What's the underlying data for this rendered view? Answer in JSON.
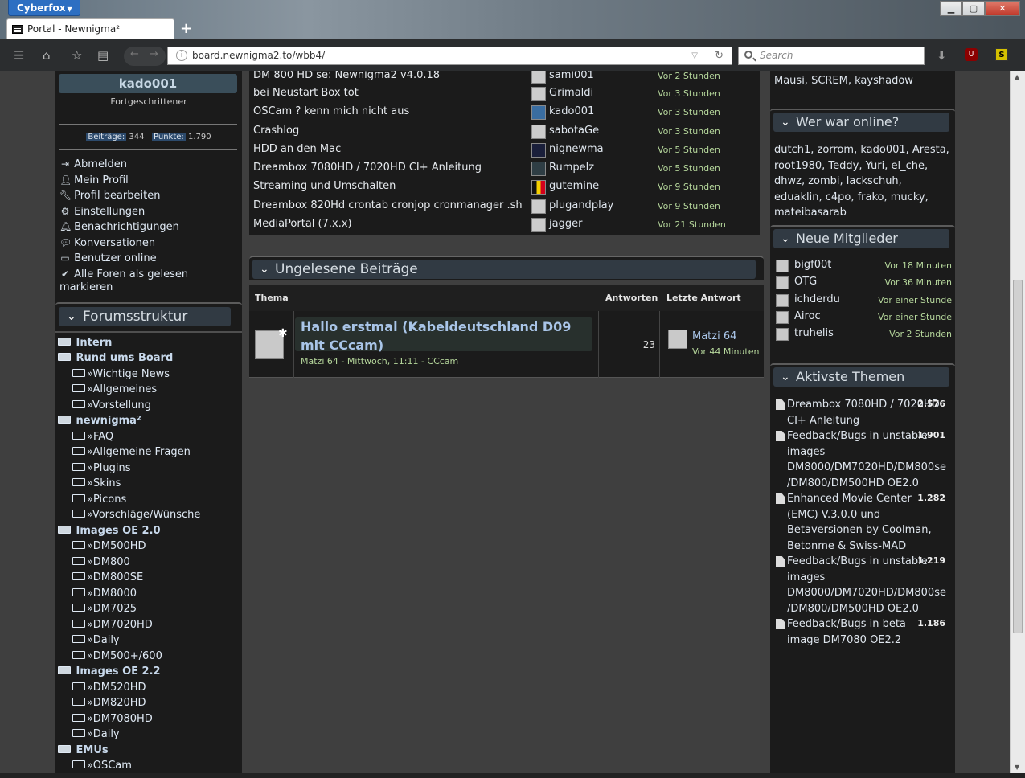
{
  "browser": {
    "app_name": "Cyberfox",
    "tab_title": "Portal - Newnigma²",
    "url": "board.newnigma2.to/wbb4/",
    "search_placeholder": "Search"
  },
  "user_panel": {
    "username": "kado001",
    "rank": "Fortgeschrittener",
    "posts_label": "Beiträge:",
    "posts_value": "344",
    "points_label": "Punkte:",
    "points_value": "1.790",
    "menu": [
      {
        "icon": "sign-out-icon",
        "label": "Abmelden"
      },
      {
        "icon": "user-icon",
        "label": "Mein Profil"
      },
      {
        "icon": "wrench-icon",
        "label": "Profil bearbeiten"
      },
      {
        "icon": "gears-icon",
        "label": "Einstellungen"
      },
      {
        "icon": "bell-icon",
        "label": "Benachrichtigungen"
      },
      {
        "icon": "comments-icon",
        "label": "Konversationen"
      },
      {
        "icon": "desktop-icon",
        "label": "Benutzer online"
      },
      {
        "icon": "check-icon",
        "label": "Alle Foren als gelesen markieren"
      }
    ]
  },
  "forum_structure": {
    "heading": "Forumsstruktur",
    "items": [
      {
        "level": 0,
        "label": "Intern"
      },
      {
        "level": 0,
        "label": "Rund ums Board"
      },
      {
        "level": 1,
        "label": "»Wichtige News"
      },
      {
        "level": 1,
        "label": "»Allgemeines"
      },
      {
        "level": 1,
        "label": "»Vorstellung"
      },
      {
        "level": 0,
        "label": "newnigma²"
      },
      {
        "level": 1,
        "label": "»FAQ"
      },
      {
        "level": 1,
        "label": "»Allgemeine Fragen"
      },
      {
        "level": 1,
        "label": "»Plugins"
      },
      {
        "level": 1,
        "label": "»Skins"
      },
      {
        "level": 1,
        "label": "»Picons"
      },
      {
        "level": 1,
        "label": "»Vorschläge/Wünsche"
      },
      {
        "level": 0,
        "label": "Images OE 2.0"
      },
      {
        "level": 1,
        "label": "»DM500HD"
      },
      {
        "level": 1,
        "label": "»DM800"
      },
      {
        "level": 1,
        "label": "»DM800SE"
      },
      {
        "level": 1,
        "label": "»DM8000"
      },
      {
        "level": 1,
        "label": "»DM7025"
      },
      {
        "level": 1,
        "label": "»DM7020HD"
      },
      {
        "level": 1,
        "label": "»Daily"
      },
      {
        "level": 1,
        "label": "»DM500+/600"
      },
      {
        "level": 0,
        "label": "Images OE 2.2"
      },
      {
        "level": 1,
        "label": "»DM520HD"
      },
      {
        "level": 1,
        "label": "»DM820HD"
      },
      {
        "level": 1,
        "label": "»DM7080HD"
      },
      {
        "level": 1,
        "label": "»Daily"
      },
      {
        "level": 0,
        "label": "EMUs"
      },
      {
        "level": 1,
        "label": "»OSCam"
      }
    ]
  },
  "recent_posts": [
    {
      "title": "DM 800 HD se: Newnigma2 v4.0.18",
      "user": "sami001",
      "time": "Vor 2 Stunden"
    },
    {
      "title": "bei Neustart Box tot",
      "user": "Grimaldi",
      "time": "Vor 3 Stunden"
    },
    {
      "title": "OSCam ? kenn mich nicht aus",
      "user": "kado001",
      "time": "Vor 3 Stunden"
    },
    {
      "title": "Crashlog",
      "user": "sabotaGe",
      "time": "Vor 3 Stunden"
    },
    {
      "title": "HDD an den Mac",
      "user": "nignewma",
      "time": "Vor 5 Stunden"
    },
    {
      "title": "Dreambox 7080HD / 7020HD CI+ Anleitung",
      "user": "Rumpelz",
      "time": "Vor 5 Stunden"
    },
    {
      "title": "Streaming und Umschalten",
      "user": "gutemine",
      "time": "Vor 9 Stunden"
    },
    {
      "title": "Dreambox 820Hd crontab cronjop cronmanager .sh",
      "user": "plugandplay",
      "time": "Vor 9 Stunden"
    },
    {
      "title": "MediaPortal (7.x.x)",
      "user": "jagger",
      "time": "Vor 21 Stunden"
    }
  ],
  "unread": {
    "heading": "Ungelesene Beiträge",
    "col_thema": "Thema",
    "col_antworten": "Antworten",
    "col_letzte": "Letzte Antwort",
    "thread_title": "Hallo erstmal (Kabeldeutschland D09 mit CCcam)",
    "thread_meta": "Matzi 64 - Mittwoch, 11:11 - CCcam",
    "replies": "23",
    "last_user": "Matzi 64",
    "last_time": "Vor 44 Minuten"
  },
  "right": {
    "top_users": "Mausi, SCREM, kayshadow",
    "was_online_heading": "Wer war online?",
    "was_online_list": "dutch1, zorrom, kado001, Aresta, root1980, Teddy, Yuri, el_che, dhwz, zombi, lackschuh, eduaklin, c4po, frako, mucky, mateibasarab",
    "new_members_heading": "Neue Mitglieder",
    "new_members": [
      {
        "name": "bigf00t",
        "time": "Vor 18 Minuten"
      },
      {
        "name": "OTG",
        "time": "Vor 36 Minuten"
      },
      {
        "name": "ichderdu",
        "time": "Vor einer Stunde"
      },
      {
        "name": "Airoc",
        "time": "Vor einer Stunde"
      },
      {
        "name": "truhelis",
        "time": "Vor 2 Stunden"
      }
    ],
    "active_heading": "Aktivste Themen",
    "active_topics": [
      {
        "title": "Dreambox 7080HD / 7020HD CI+ Anleitung",
        "count": "2.576"
      },
      {
        "title": "Feedback/Bugs in unstable images DM8000/DM7020HD/DM800se /DM800/DM500HD OE2.0",
        "count": "1.901"
      },
      {
        "title": "Enhanced Movie Center (EMC) V.3.0.0 und Betaversionen by Coolman, Betonme & Swiss-MAD",
        "count": "1.282"
      },
      {
        "title": "Feedback/Bugs in unstable images DM8000/DM7020HD/DM800se /DM800/DM500HD OE2.0",
        "count": "1.219"
      },
      {
        "title": "Feedback/Bugs in beta image DM7080 OE2.2",
        "count": "1.186"
      }
    ]
  }
}
